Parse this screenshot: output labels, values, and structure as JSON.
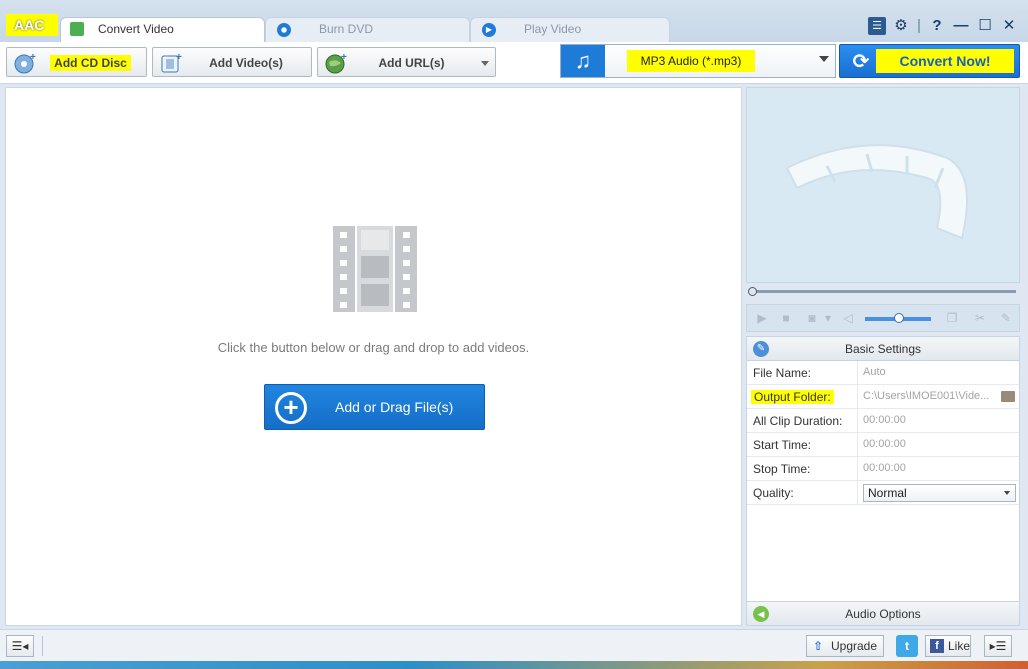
{
  "app": {
    "logo": "AAC"
  },
  "tabs": [
    {
      "label": "Convert Video",
      "active": true
    },
    {
      "label": "Burn DVD",
      "active": false
    },
    {
      "label": "Play Video",
      "active": false
    }
  ],
  "window_controls": {
    "list_icon": "list-icon",
    "settings_icon": "gear-icon",
    "help": "?",
    "minimize": "—",
    "maximize": "☐",
    "close": "✕"
  },
  "toolbar": {
    "add_cd": "Add CD Disc",
    "add_video": "Add Video(s)",
    "add_url": "Add URL(s)",
    "format": "MP3 Audio (*.mp3)",
    "convert": "Convert Now!"
  },
  "main": {
    "hint": "Click the button below or drag and drop to add videos.",
    "add_files": "Add or Drag File(s)"
  },
  "settings": {
    "title": "Basic Settings",
    "rows": [
      {
        "key": "File Name:",
        "value": "Auto"
      },
      {
        "key": "Output Folder:",
        "value": "C:\\Users\\IMOE001\\Vide..."
      },
      {
        "key": "All Clip Duration:",
        "value": "00:00:00"
      },
      {
        "key": "Start Time:",
        "value": "00:00:00"
      },
      {
        "key": "Stop Time:",
        "value": "00:00:00"
      },
      {
        "key": "Quality:",
        "value": "Normal"
      }
    ],
    "audio_options": "Audio Options"
  },
  "statusbar": {
    "upgrade": "Upgrade",
    "like": "Like"
  },
  "colors": {
    "accent": "#1b6fd0",
    "highlight": "#ffff00"
  }
}
